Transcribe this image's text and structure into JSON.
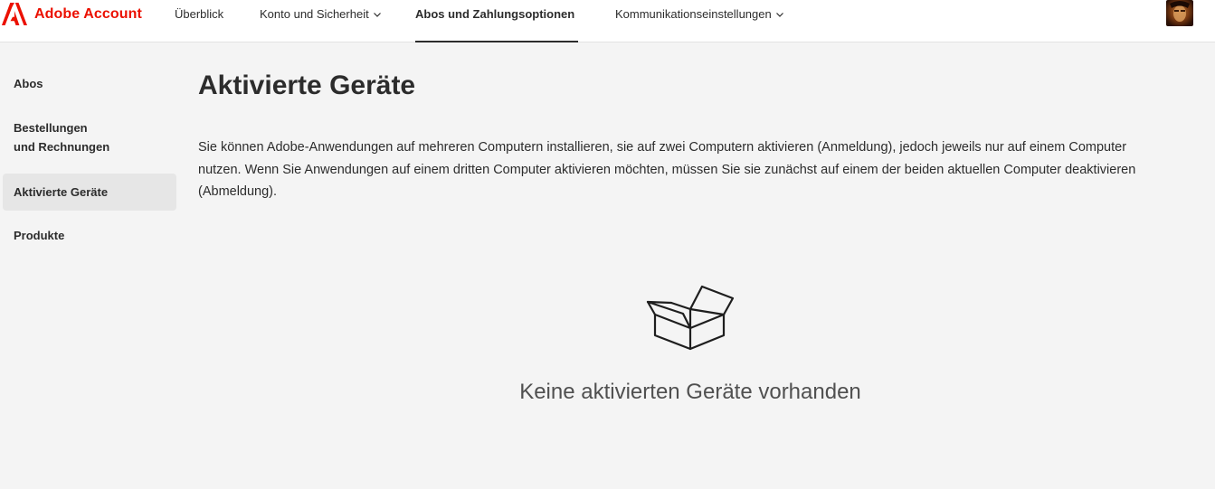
{
  "header": {
    "brand_name": "Adobe Account",
    "logo_icon": "adobe-logo-icon",
    "brand_color": "#eb1000",
    "nav": [
      {
        "label": "Überblick",
        "has_dropdown": false,
        "active": false
      },
      {
        "label": "Konto und Sicherheit",
        "has_dropdown": true,
        "active": false
      },
      {
        "label": "Abos und Zahlungsoptionen",
        "has_dropdown": true,
        "active": true
      },
      {
        "label": "Kommunikationseinstellungen",
        "has_dropdown": true,
        "active": false
      }
    ],
    "avatar_icon": "user-avatar"
  },
  "sidebar": {
    "items": [
      {
        "label": "Abos",
        "active": false
      },
      {
        "label": "Bestellungen und Rechnungen",
        "active": false
      },
      {
        "label": "Aktivierte Geräte",
        "active": true
      },
      {
        "label": "Produkte",
        "active": false
      }
    ]
  },
  "main": {
    "title": "Aktivierte Geräte",
    "description": "Sie können Adobe-Anwendungen auf mehreren Computern installieren, sie auf zwei Computern aktivieren (Anmeldung), jedoch jeweils nur auf einem Computer nutzen. Wenn Sie Anwendungen auf einem dritten Computer aktivieren möchten, müssen Sie sie zunächst auf einem der beiden aktuellen Computer deaktivieren (Abmeldung).",
    "empty_state": {
      "icon": "open-box-icon",
      "text": "Keine aktivierten Geräte vorhanden"
    }
  },
  "colors": {
    "page_background": "#f4f4f4",
    "header_background": "#ffffff",
    "active_sidebar_background": "#e6e6e6",
    "text": "#2c2c2c"
  }
}
